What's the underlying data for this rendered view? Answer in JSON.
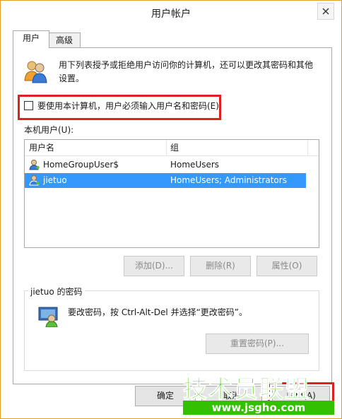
{
  "window": {
    "title": "用户帐户"
  },
  "tabs": [
    {
      "label": "用户",
      "active": true
    },
    {
      "label": "高级",
      "active": false
    }
  ],
  "intro": {
    "line1": "用下列表授予或拒绝用户访问你的计算机，还可以更改其密码和其他",
    "line2": "设置。"
  },
  "require_login": {
    "label": "要使用本计算机，用户必须输入用户名和密码(E)",
    "checked": false
  },
  "local_users": {
    "label": "本机用户(U):",
    "columns": [
      "用户名",
      "组"
    ],
    "rows": [
      {
        "name": "HomeGroupUser$",
        "group": "HomeUsers",
        "selected": false
      },
      {
        "name": "jietuo",
        "group": "HomeUsers; Administrators",
        "selected": true
      }
    ]
  },
  "user_buttons": {
    "add": "添加(D)...",
    "remove": "删除(R)",
    "properties": "属性(O)"
  },
  "password_section": {
    "title": "jietuo 的密码",
    "text": "要改密码，按 Ctrl-Alt-Del 并选择“更改密码”。",
    "reset_button": "重置密码(P)..."
  },
  "dialog_buttons": {
    "ok": "确定",
    "cancel": "取消",
    "apply": "应用(A)"
  },
  "watermark": {
    "brand": "技术员联盟",
    "url": "www.jsgho.com"
  },
  "colors": {
    "selection": "#3399ff",
    "highlight_border": "#e02020",
    "watermark_green": "#39c600",
    "window_border": "#e0a02a"
  },
  "icons": {
    "close": "close-icon",
    "users": "users-icon",
    "user": "user-icon",
    "password": "key-user-icon"
  }
}
